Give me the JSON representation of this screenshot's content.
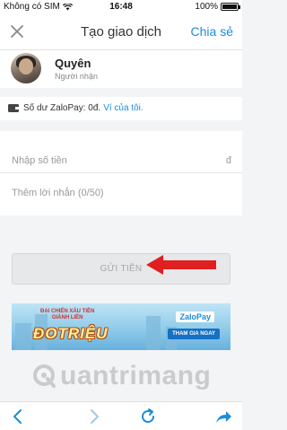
{
  "status_bar": {
    "carrier": "Không có SIM",
    "time": "16:48",
    "battery": "100%"
  },
  "nav": {
    "title": "Tạo giao dịch",
    "share_label": "Chia sẻ",
    "close_icon": "close-icon"
  },
  "recipient": {
    "name": "Quyên",
    "role": "Người nhận"
  },
  "balance": {
    "text": "Số dư ZaloPay: 0đ.",
    "link": "Ví của tôi."
  },
  "form": {
    "amount_placeholder": "Nhập số tiền",
    "currency": "đ",
    "message_placeholder": "Thêm lời nhắn (0/50)"
  },
  "send_button": {
    "label": "GỬI TIỀN"
  },
  "banner": {
    "subtitle_line1": "ĐẠI CHIẾN XÁU TIỀN",
    "subtitle_line2": "GIÀNH LIỀN",
    "title": "ĐOTRIỆU",
    "logo": "ZaloPay",
    "cta": "THAM GIA NGAY"
  },
  "watermark": {
    "text": "uantrimang"
  },
  "colors": {
    "accent": "#1a8ddb",
    "arrow": "#e0201e",
    "disabled_button": "#e7e8ea"
  },
  "toolbar": {
    "icons": [
      "back-icon",
      "forward-icon",
      "reload-icon",
      "share-arrow-icon"
    ]
  }
}
